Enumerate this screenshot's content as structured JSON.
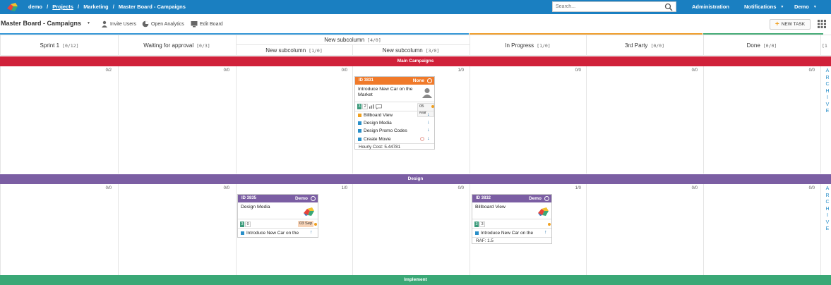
{
  "topbar": {
    "crumbs": [
      "demo",
      "/",
      "Projects",
      "/",
      "Marketing",
      "/",
      "Master Board - Campaigns"
    ],
    "search_placeholder": "Search...",
    "nav": [
      "Administration",
      "Notifications",
      "Demo"
    ]
  },
  "toolbar": {
    "title": "Master Board - Campaigns",
    "invite": "Invite Users",
    "analytics": "Open Analytics",
    "edit": "Edit Board",
    "new_task": "NEW TASK"
  },
  "columns": {
    "sprint": {
      "name": "Sprint 1",
      "count": "[0/12]"
    },
    "waiting": {
      "name": "Waiting for approval",
      "count": "[0/3]"
    },
    "newsub_parent": {
      "name": "New subcolumn",
      "count": "[4/0]"
    },
    "newsub1": {
      "name": "New subcolumn",
      "count": "[1/0]"
    },
    "newsub2": {
      "name": "New subcolumn",
      "count": "[3/0]"
    },
    "inprogress": {
      "name": "In Progress",
      "count": "[1/0]"
    },
    "thirdparty": {
      "name": "3rd Party",
      "count": "[0/0]"
    },
    "done": {
      "name": "Done",
      "count": "[0/0]"
    },
    "archive": {
      "count": "[1"
    }
  },
  "colors": {
    "topbar": "#1a7fc1",
    "lane_main": "#d0213a",
    "lane_design": "#7b5ea3",
    "lane_implement": "#3aa876",
    "card_orange": "#f07a2a",
    "card_purple": "#7b5ea3",
    "line_blue": "#3a9ad9",
    "line_orange": "#f0a030",
    "line_green": "#4aae7a"
  },
  "lanes": {
    "main": {
      "name": "Main Campaigns",
      "counts": [
        "0/2",
        "0/0",
        "0/0",
        "1/0",
        "0/0",
        "0/0",
        "0/0"
      ]
    },
    "design": {
      "name": "Design",
      "counts": [
        "0/0",
        "0/0",
        "1/0",
        "0/0",
        "1/0",
        "0/0",
        "0/0"
      ]
    },
    "implement": {
      "name": "Implement"
    }
  },
  "archive_letters": [
    "A",
    "R",
    "C",
    "H",
    "I",
    "V",
    "E"
  ],
  "cards": {
    "c3831": {
      "id": "ID 3831",
      "owner": "None",
      "title": "Introduce New Car on the Market",
      "num": "3",
      "num2": "2",
      "date": "05 Mar",
      "subtasks": [
        "Billboard View",
        "Design Media",
        "Design Promo Codes",
        "Create Movie"
      ],
      "footer": "Hourly Cost: 5.44781"
    },
    "c3835": {
      "id": "ID 3835",
      "owner": "Demo",
      "title": "Design Media",
      "num": "3",
      "num2": "0",
      "date": "03 Sep",
      "parent": "Introduce New Car on the"
    },
    "c3832": {
      "id": "ID 3832",
      "owner": "Demo",
      "title": "Billboard View",
      "num": "3",
      "num2": "3",
      "parent": "Introduce New Car on the",
      "footer": "RAF: 1.5"
    }
  }
}
